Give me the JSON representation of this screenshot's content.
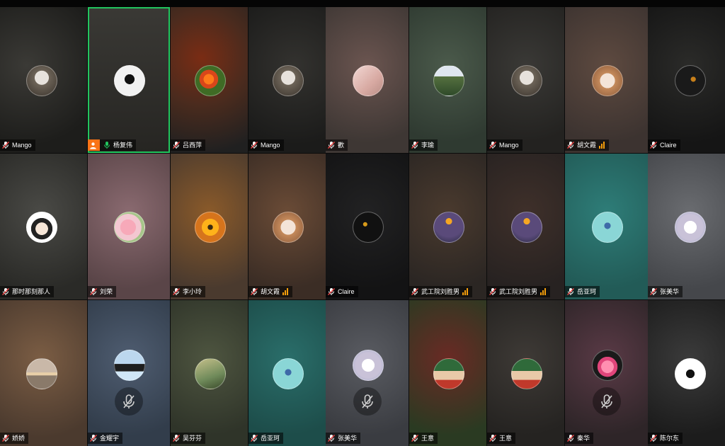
{
  "colors": {
    "active_speaker_border": "#22c55e",
    "host_badge": "#f97316",
    "signal_bars": "#f59e0b",
    "label_text": "#ffffff"
  },
  "participants": [
    {
      "name": "Mango",
      "active": false,
      "host": false,
      "muted": true,
      "signal": false,
      "big_muted": false,
      "avatar_icon": "person-photo-avatar"
    },
    {
      "name": "杨复伟",
      "active": true,
      "host": true,
      "muted": false,
      "signal": false,
      "big_muted": false,
      "avatar_icon": "person-standing-avatar"
    },
    {
      "name": "吕西萍",
      "active": false,
      "host": false,
      "muted": true,
      "signal": false,
      "big_muted": false,
      "avatar_icon": "flowers-avatar"
    },
    {
      "name": "Mango",
      "active": false,
      "host": false,
      "muted": true,
      "signal": false,
      "big_muted": false,
      "avatar_icon": "person-photo-avatar"
    },
    {
      "name": "歡",
      "active": false,
      "host": false,
      "muted": true,
      "signal": false,
      "big_muted": false,
      "avatar_icon": "desk-photo-avatar"
    },
    {
      "name": "李瑜",
      "active": false,
      "host": false,
      "muted": true,
      "signal": false,
      "big_muted": false,
      "avatar_icon": "garden-avatar"
    },
    {
      "name": "Mango",
      "active": false,
      "host": false,
      "muted": true,
      "signal": false,
      "big_muted": false,
      "avatar_icon": "person-photo-avatar"
    },
    {
      "name": "胡文霞",
      "active": false,
      "host": false,
      "muted": true,
      "signal": true,
      "big_muted": false,
      "avatar_icon": "face-avatar"
    },
    {
      "name": "Claire",
      "active": false,
      "host": false,
      "muted": true,
      "signal": false,
      "big_muted": false,
      "avatar_icon": "dark-abstract-avatar"
    },
    {
      "name": "那时那刻那人",
      "active": false,
      "host": false,
      "muted": true,
      "signal": false,
      "big_muted": false,
      "avatar_icon": "cartoon-girl-avatar"
    },
    {
      "name": "刘荣",
      "active": false,
      "host": false,
      "muted": true,
      "signal": false,
      "big_muted": false,
      "avatar_icon": "pink-flower-avatar"
    },
    {
      "name": "李小玲",
      "active": false,
      "host": false,
      "muted": true,
      "signal": false,
      "big_muted": false,
      "avatar_icon": "sunflower-avatar"
    },
    {
      "name": "胡文霞",
      "active": false,
      "host": false,
      "muted": true,
      "signal": true,
      "big_muted": false,
      "avatar_icon": "face-avatar"
    },
    {
      "name": "Claire",
      "active": false,
      "host": false,
      "muted": true,
      "signal": false,
      "big_muted": false,
      "avatar_icon": "dark-abstract-avatar"
    },
    {
      "name": "武工院刘胜男",
      "active": false,
      "host": false,
      "muted": true,
      "signal": true,
      "big_muted": false,
      "avatar_icon": "lantern-night-avatar"
    },
    {
      "name": "武工院刘胜男",
      "active": false,
      "host": false,
      "muted": true,
      "signal": true,
      "big_muted": false,
      "avatar_icon": "lantern-night-avatar"
    },
    {
      "name": "岳亚珂",
      "active": false,
      "host": false,
      "muted": true,
      "signal": false,
      "big_muted": false,
      "avatar_icon": "dancer-avatar"
    },
    {
      "name": "张美华",
      "active": false,
      "host": false,
      "muted": true,
      "signal": false,
      "big_muted": false,
      "avatar_icon": "anime-girl-avatar"
    },
    {
      "name": "娇娇",
      "active": false,
      "host": false,
      "muted": true,
      "signal": false,
      "big_muted": false,
      "avatar_icon": "sunset-sea-avatar"
    },
    {
      "name": "金耀宇",
      "active": false,
      "host": false,
      "muted": true,
      "signal": false,
      "big_muted": true,
      "avatar_icon": "penguin-avatar"
    },
    {
      "name": "吴芬芬",
      "active": false,
      "host": false,
      "muted": true,
      "signal": false,
      "big_muted": false,
      "avatar_icon": "landscape-avatar"
    },
    {
      "name": "岳亚珂",
      "active": false,
      "host": false,
      "muted": true,
      "signal": false,
      "big_muted": false,
      "avatar_icon": "dancer-avatar"
    },
    {
      "name": "张美华",
      "active": false,
      "host": false,
      "muted": true,
      "signal": false,
      "big_muted": true,
      "avatar_icon": "anime-girl-avatar"
    },
    {
      "name": "王意",
      "active": false,
      "host": false,
      "muted": true,
      "signal": false,
      "big_muted": false,
      "avatar_icon": "man-banner-avatar"
    },
    {
      "name": "王意",
      "active": false,
      "host": false,
      "muted": true,
      "signal": false,
      "big_muted": false,
      "avatar_icon": "man-banner-avatar"
    },
    {
      "name": "秦华",
      "active": false,
      "host": false,
      "muted": true,
      "signal": false,
      "big_muted": true,
      "avatar_icon": "lotus-avatar"
    },
    {
      "name": "陈尔东",
      "active": false,
      "host": false,
      "muted": true,
      "signal": false,
      "big_muted": false,
      "avatar_icon": "calligraphy-logo-avatar"
    }
  ]
}
